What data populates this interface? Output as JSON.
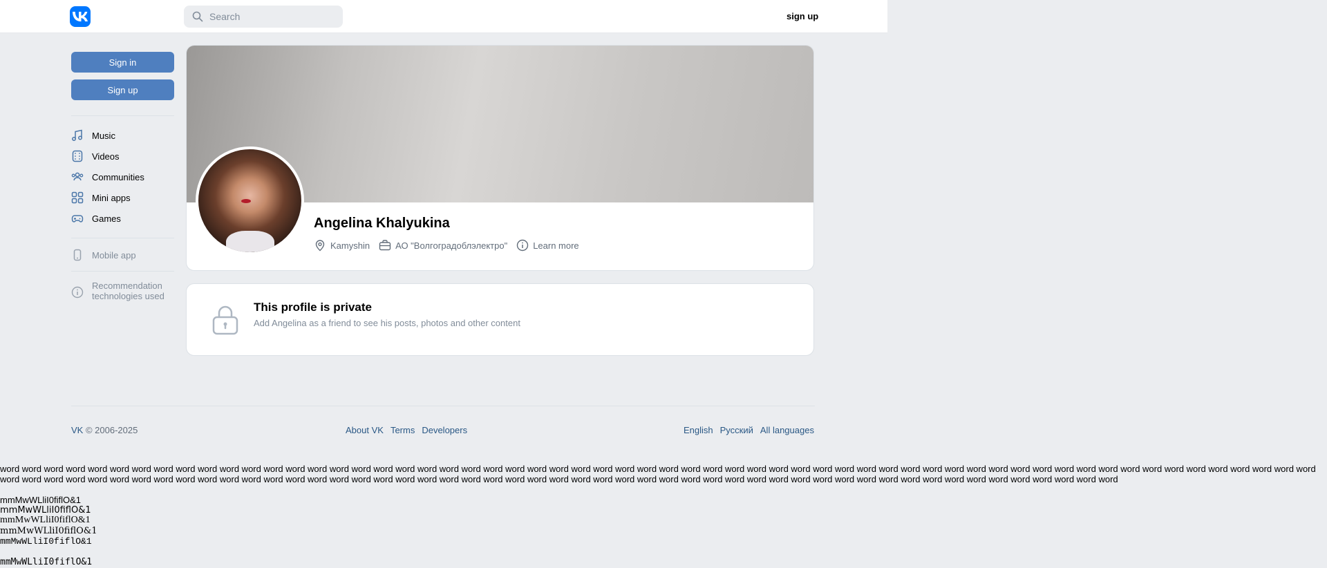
{
  "header": {
    "logo_text": "VK",
    "search_placeholder": "Search",
    "signup_label": "sign up"
  },
  "sidebar": {
    "signin_label": "Sign in",
    "signup_label": "Sign up",
    "items": [
      {
        "label": "Music",
        "icon": "music-icon"
      },
      {
        "label": "Videos",
        "icon": "video-icon"
      },
      {
        "label": "Communities",
        "icon": "communities-icon"
      },
      {
        "label": "Mini apps",
        "icon": "mini-apps-icon"
      },
      {
        "label": "Games",
        "icon": "gamepad-icon"
      }
    ],
    "mobile_app": "Mobile app",
    "recommendation_line1": "Recommendation",
    "recommendation_line2": "technologies used"
  },
  "profile": {
    "name": "Angelina Khalyukina",
    "city": "Kamyshin",
    "work": "АО \"Волгоградоблэлектро\"",
    "learn_more": "Learn more"
  },
  "private": {
    "title": "This profile is private",
    "subtitle": "Add Angelina as a friend to see his posts, photos and other content"
  },
  "footer": {
    "vk": "VK",
    "copyright": " © 2006-2025",
    "links": [
      "About VK",
      "Terms",
      "Developers"
    ],
    "languages": [
      "English",
      "Русский",
      "All languages"
    ]
  },
  "test_text": {
    "words": "word word word word word word word word word word word word word word word word word word word word word word word word word word word word word word word word word word word word word word word word word word word word word word word word word word word word word word word word word word word word word word word word word word word word word word word word word word word word word word word word word word word word word word word word word word word word word word word word word word word word word word word word word word word word word word word",
    "samples": [
      "mmMwWLliI0fiflO&1",
      "mmMwWLliI0fiflO&1",
      "mmMwWLliI0fiflO&1",
      "mmMwWLliI0fiflO&1",
      "mmMwWLliI0fiflO&1",
      "mmMwWLliI0fiflO&1"
    ]
  },
  "colors": {
    "accent": "#0077ff",
    "button": "#4f7fbf",
    "background": "#ebedf0",
    "link": "#2a5885"
  }
}
